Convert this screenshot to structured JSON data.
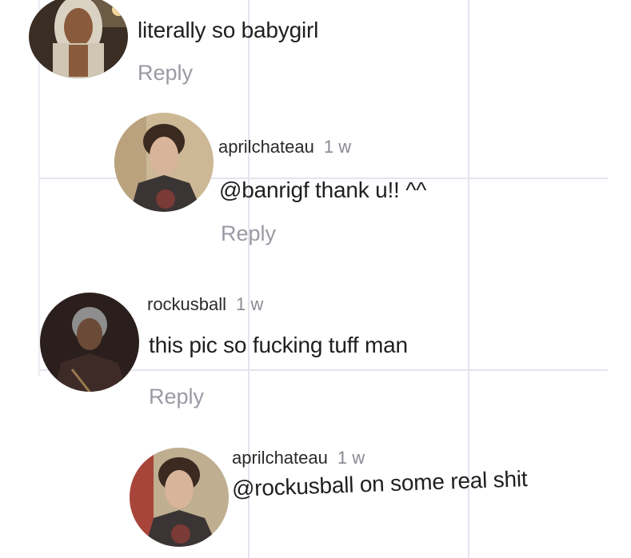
{
  "comments": [
    {
      "username": "",
      "time": "",
      "text": "literally so babygirl",
      "reply_label": "Reply"
    },
    {
      "username": "aprilchateau",
      "time": "1 w",
      "text": "@banrigf thank u!! ^^",
      "reply_label": "Reply"
    },
    {
      "username": "rockusball",
      "time": "1 w",
      "text": "this pic so fucking tuff man",
      "reply_label": "Reply"
    },
    {
      "username": "aprilchateau",
      "time": "1 w",
      "text": "@rockusball on some real shit",
      "reply_label": ""
    }
  ],
  "colors": {
    "text": "#1f1f1f",
    "muted": "#9a9aa3",
    "grid": "#e4e4ee"
  }
}
